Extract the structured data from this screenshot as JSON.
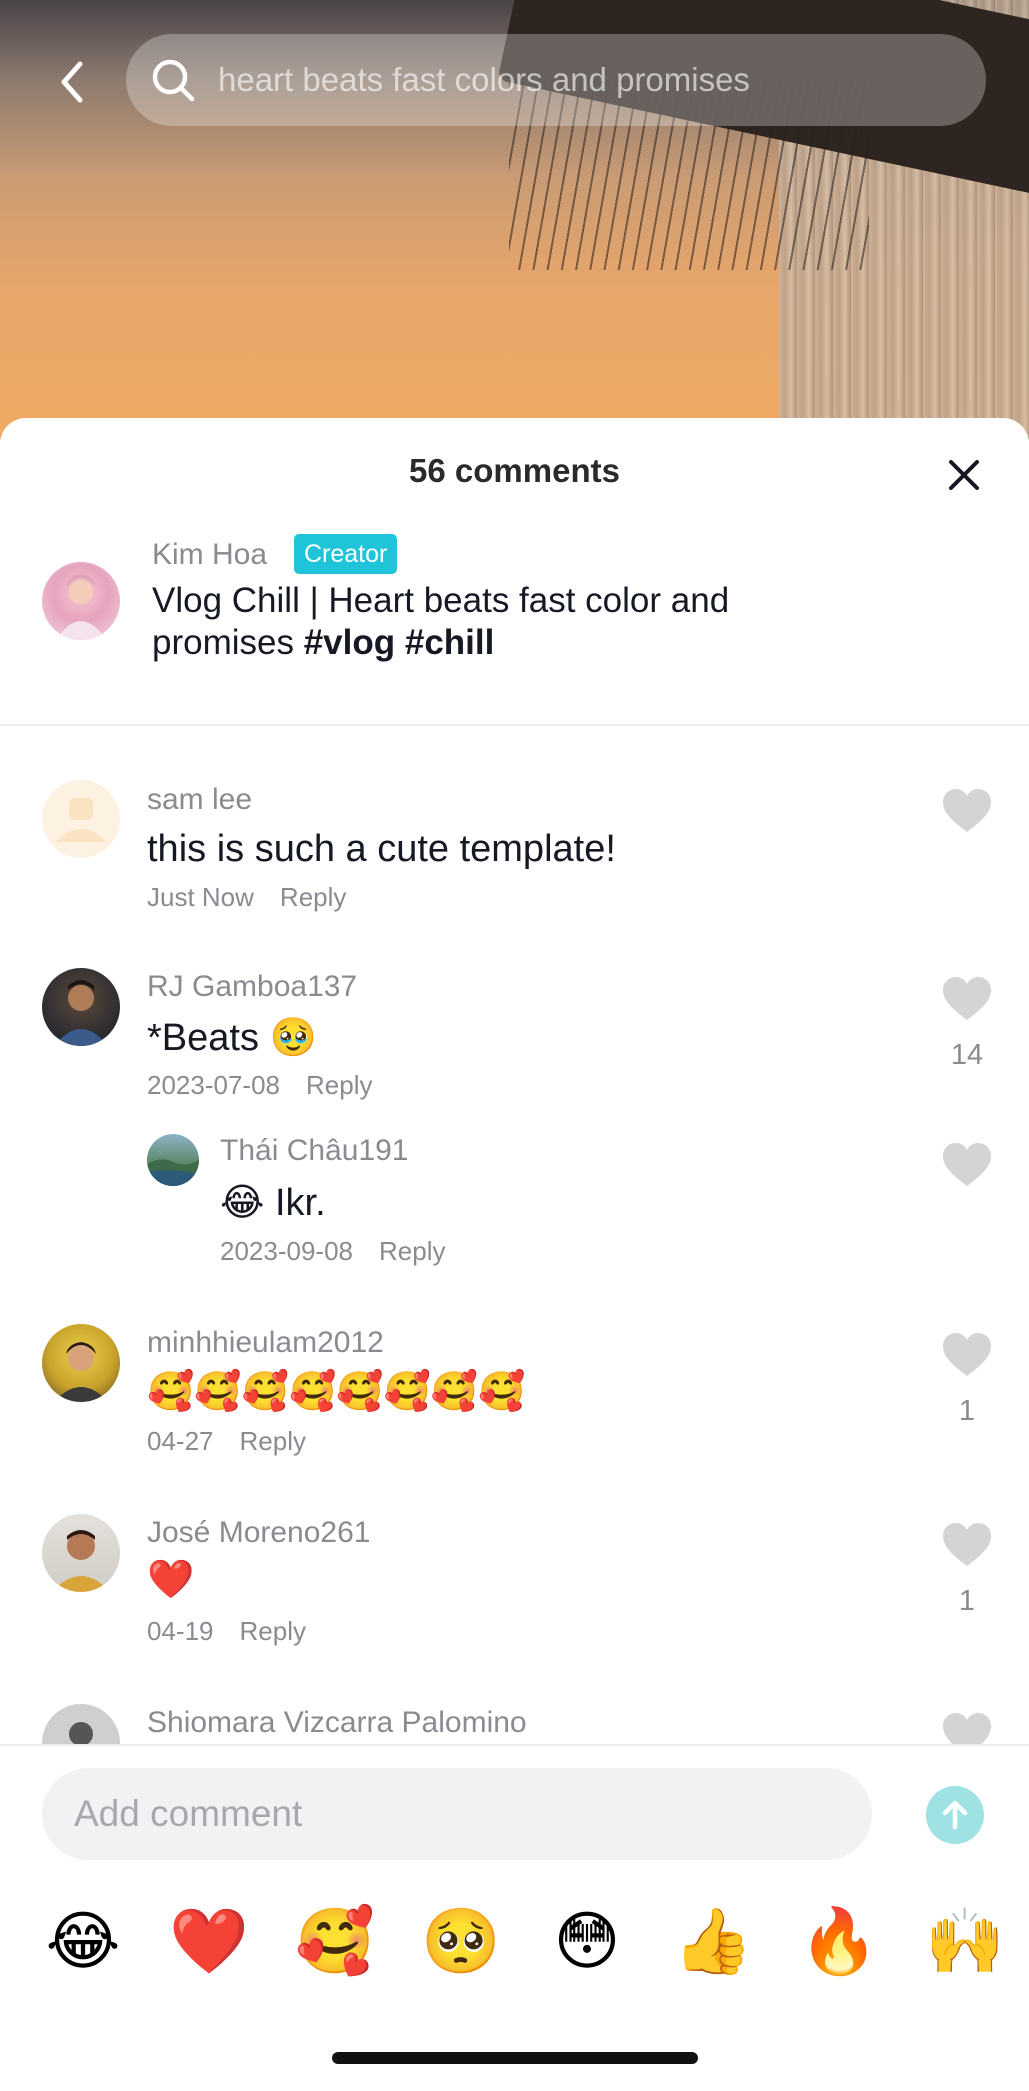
{
  "search": {
    "query": "heart beats fast colors and promises"
  },
  "sheet": {
    "title": "56 comments"
  },
  "caption": {
    "author": "Kim Hoa",
    "badge": "Creator",
    "text": "Vlog Chill | Heart beats fast color and promises ",
    "tag1": "#vlog",
    "tag2": "#chill"
  },
  "comments": [
    {
      "user": "sam lee",
      "text": "this is such a cute template!",
      "time": "Just Now",
      "reply": "Reply",
      "likes": ""
    },
    {
      "user": "RJ Gamboa137",
      "text": "*Beats 🥹",
      "time": "2023-07-08",
      "reply": "Reply",
      "likes": "14"
    },
    {
      "user": "Thái Châu191",
      "text": "😂 Ikr.",
      "time": "2023-09-08",
      "reply": "Reply",
      "likes": ""
    },
    {
      "user": "minhhieulam2012",
      "text": "🥰🥰🥰🥰🥰🥰🥰🥰",
      "time": "04-27",
      "reply": "Reply",
      "likes": "1"
    },
    {
      "user": "José Moreno261",
      "text": "❤️",
      "time": "04-19",
      "reply": "Reply",
      "likes": "1"
    },
    {
      "user": "Shiomara Vizcarra Palomino",
      "text": "",
      "time": "",
      "reply": "",
      "likes": ""
    }
  ],
  "input": {
    "placeholder": "Add comment"
  },
  "emoji_bar": [
    "😂",
    "❤️",
    "🥰",
    "🥺",
    "😳",
    "👍",
    "🔥",
    "🙌"
  ],
  "colors": {
    "creator_badge": "#20c4d8",
    "send_button": "#9fe2e4",
    "like_heart": "#d3d4d6",
    "secondary_text": "#8a8b91"
  }
}
